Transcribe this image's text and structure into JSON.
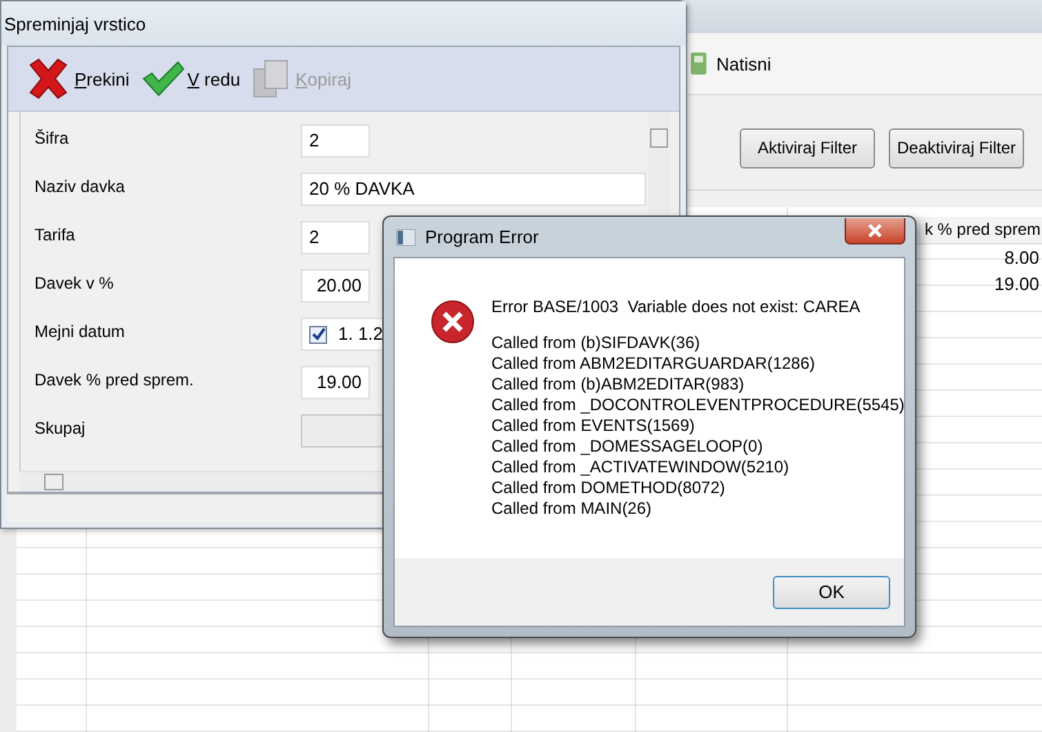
{
  "background_window": {
    "toolbar": [
      {
        "label": "Natisni"
      }
    ],
    "filter_buttons": [
      "Aktiviraj Filter",
      "Deaktiviraj Filter"
    ],
    "table": {
      "columns": [
        "k % pred sprem"
      ],
      "rows": [
        [
          "8.00"
        ],
        [
          "19.00"
        ]
      ]
    }
  },
  "edit_window": {
    "title": "Spreminjaj vrstico",
    "toolbar": [
      {
        "label": "Prekini",
        "kind": "cancel",
        "disabled": false
      },
      {
        "label": "V redu",
        "kind": "ok",
        "disabled": false
      },
      {
        "label": "Kopiraj",
        "kind": "copy",
        "disabled": true
      }
    ],
    "fields": [
      {
        "label": "Šifra",
        "kind": "text",
        "value": "2"
      },
      {
        "label": "Naziv davka",
        "kind": "wide",
        "value": "20 % DAVKA"
      },
      {
        "label": "Tarifa",
        "kind": "text",
        "value": "2"
      },
      {
        "label": "Davek v %",
        "kind": "number",
        "value": "20.00"
      },
      {
        "label": "Mejni datum",
        "kind": "checkdate",
        "checked": true,
        "value": "1.  1.2"
      },
      {
        "label": "Davek % pred sprem.",
        "kind": "number",
        "value": "19.00"
      },
      {
        "label": "Skupaj",
        "kind": "empty"
      }
    ]
  },
  "error_dialog": {
    "title": "Program Error",
    "message": "Error BASE/1003  Variable does not exist: CAREA",
    "trace": [
      "Called from (b)SIFDAVK(36)",
      "Called from ABM2EDITARGUARDAR(1286)",
      "Called from (b)ABM2EDITAR(983)",
      "Called from _DOCONTROLEVENTPROCEDURE(5545)",
      "Called from EVENTS(1569)",
      "Called from _DOMESSAGELOOP(0)",
      "Called from _ACTIVATEWINDOW(5210)",
      "Called from DOMETHOD(8072)",
      "Called from MAIN(26)"
    ],
    "ok_button": "OK"
  }
}
